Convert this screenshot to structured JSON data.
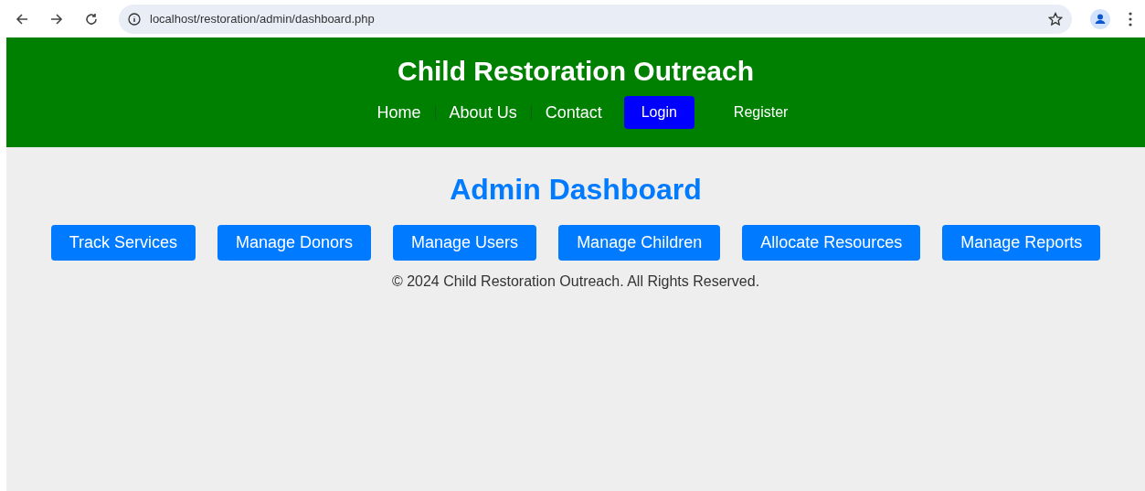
{
  "browser": {
    "url": "localhost/restoration/admin/dashboard.php"
  },
  "header": {
    "title": "Child Restoration Outreach",
    "nav": [
      {
        "label": "Home",
        "kind": "link"
      },
      {
        "label": "About Us",
        "kind": "link"
      },
      {
        "label": "Contact",
        "kind": "link"
      },
      {
        "label": "Login",
        "kind": "button"
      },
      {
        "label": "Register",
        "kind": "plain"
      }
    ]
  },
  "main": {
    "title": "Admin Dashboard",
    "buttons": [
      "Track Services",
      "Manage Donors",
      "Manage Users",
      "Manage Children",
      "Allocate Resources",
      "Manage Reports"
    ]
  },
  "footer": {
    "text": "© 2024 Child Restoration Outreach. All Rights Reserved."
  }
}
